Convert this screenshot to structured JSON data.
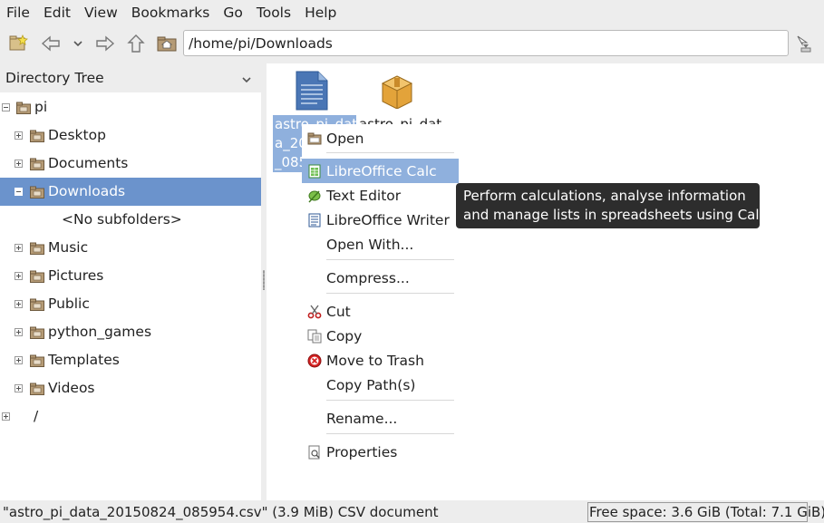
{
  "menubar": {
    "items": [
      "File",
      "Edit",
      "View",
      "Bookmarks",
      "Go",
      "Tools",
      "Help"
    ]
  },
  "toolbar": {
    "icons": [
      "new-window-icon",
      "back-icon",
      "history-dropdown-icon",
      "forward-icon",
      "up-icon",
      "home-icon",
      "jump-icon"
    ],
    "path": "/home/pi/Downloads"
  },
  "sidebar": {
    "header": "Directory Tree",
    "tree": [
      {
        "label": "pi",
        "expander": "minus",
        "icon": "home-folder-icon",
        "selected": false
      },
      {
        "label": "Desktop",
        "expander": "plus",
        "icon": "desktop-folder-icon",
        "selected": false
      },
      {
        "label": "Documents",
        "expander": "plus",
        "icon": "documents-folder-icon",
        "selected": false
      },
      {
        "label": "Downloads",
        "expander": "minus",
        "icon": "downloads-folder-icon",
        "selected": true
      },
      {
        "label": "<No subfolders>",
        "expander": "none",
        "icon": "",
        "selected": false
      },
      {
        "label": "Music",
        "expander": "plus",
        "icon": "music-folder-icon",
        "selected": false
      },
      {
        "label": "Pictures",
        "expander": "plus",
        "icon": "pictures-folder-icon",
        "selected": false
      },
      {
        "label": "Public",
        "expander": "plus",
        "icon": "public-folder-icon",
        "selected": false
      },
      {
        "label": "python_games",
        "expander": "plus",
        "icon": "folder-icon",
        "selected": false
      },
      {
        "label": "Templates",
        "expander": "plus",
        "icon": "templates-folder-icon",
        "selected": false
      },
      {
        "label": "Videos",
        "expander": "plus",
        "icon": "videos-folder-icon",
        "selected": false
      },
      {
        "label": "/",
        "expander": "plus",
        "icon": "folder-icon",
        "selected": false
      }
    ]
  },
  "files": [
    {
      "name_lines": [
        "astro_pi_dat",
        "a_20",
        "_085"
      ],
      "icon": "spreadsheet-file-icon",
      "selected": true
    },
    {
      "name_lines": [
        "astro_pi_dat"
      ],
      "icon": "package-file-icon",
      "selected": false
    }
  ],
  "context_menu": {
    "items": [
      {
        "label": "Open",
        "icon": "folder-open-icon"
      },
      {
        "label": "LibreOffice Calc",
        "icon": "calc-icon",
        "highlighted": true
      },
      {
        "label": "Text Editor",
        "icon": "text-editor-icon"
      },
      {
        "label": "LibreOffice Writer",
        "icon": "writer-icon"
      },
      {
        "label": "Open With...",
        "icon": ""
      },
      {
        "label": "Compress...",
        "icon": ""
      },
      {
        "label": "Cut",
        "icon": "scissors-icon"
      },
      {
        "label": "Copy",
        "icon": "copy-icon"
      },
      {
        "label": "Move to Trash",
        "icon": "trash-icon"
      },
      {
        "label": "Copy Path(s)",
        "icon": ""
      },
      {
        "label": "Rename...",
        "icon": ""
      },
      {
        "label": "Properties",
        "icon": "properties-icon"
      }
    ]
  },
  "tooltip": {
    "line1": "Perform calculations, analyse information",
    "line2": "and manage lists in spreadsheets using Calc."
  },
  "statusbar": {
    "left": "\"astro_pi_data_20150824_085954.csv\" (3.9 MiB) CSV document",
    "right": "Free space: 3.6 GiB (Total: 7.1 GiB)"
  },
  "colors": {
    "selection": "#6b93cc",
    "menu_highlight": "#8fb0dd",
    "tooltip_bg": "#2d2d2d",
    "folder": "#b59b76"
  }
}
